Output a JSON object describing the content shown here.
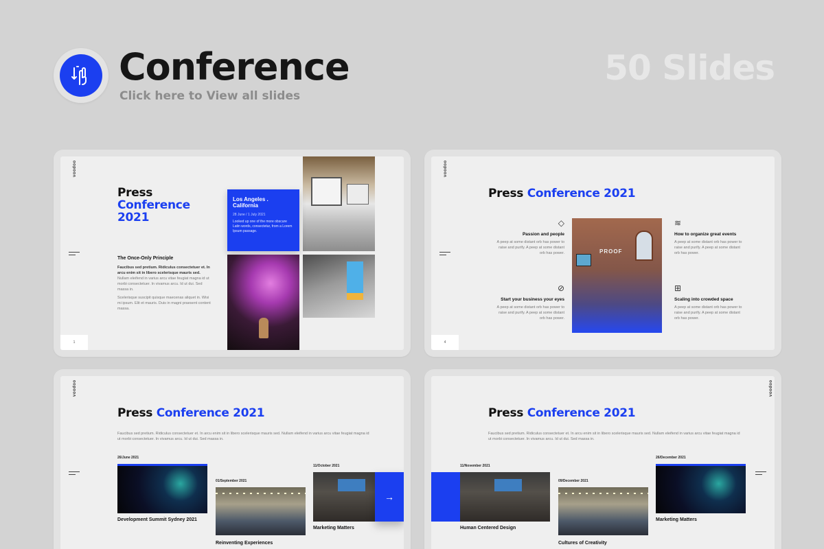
{
  "header": {
    "title": "Conference",
    "subtitle": "Click here to View all slides",
    "slides_count": "50 Slides",
    "logo_icon": "hand-swipe-icon"
  },
  "colors": {
    "accent": "#1b3ff0",
    "background": "#d3d3d3"
  },
  "brand": "voodoo",
  "slide1": {
    "title_line1": "Press",
    "title_line2": "Conference",
    "title_line3": "2021",
    "box_location": "Los Angeles . California",
    "box_date": "28 June / 1 July 2021",
    "box_desc": "Looked up one of the more obscure Latin words, consectetur, from a Lorem Ipsum passage.",
    "section_heading": "The Once-Only Principle",
    "para1_bold": "Faucibus sed pretium. Ridiculus consectetuer et. In arcu enim sit in libero scelerisque mauris sed.",
    "para1": "Nullam eleifend in varius arcu vitae feugiat magna id ut morbi consectetuer. In vivamus arcu. Id ut dui. Sed massa in.",
    "para2": "Scelerisque suscipit quisque maecenas aliquet in. Wisi mi ipsum. Elit et mauris. Duis in magni praesent content massa.",
    "page": "1"
  },
  "slide2": {
    "title_a": "Press",
    "title_b": "Conference 2021",
    "features": [
      {
        "icon": "diamond-icon",
        "label": "Passion and people",
        "text": "A peep at some distant orb has power to raise and purify. A peep at some distant orb has power."
      },
      {
        "icon": "layers-icon",
        "label": "How to organize great events",
        "text": "A peep at some distant orb has power to raise and purify. A peep at some distant orb has power."
      },
      {
        "icon": "badge-icon",
        "label": "Start your business your eyes",
        "text": "A peep at some distant orb has power to raise and purify. A peep at some distant orb has power."
      },
      {
        "icon": "gift-icon",
        "label": "Scaling into crowded space",
        "text": "A peep at some distant orb has power to raise and purify. A peep at some distant orb has power."
      }
    ],
    "photo_sign": "PROOF",
    "page": "4"
  },
  "slide3": {
    "title_a": "Press",
    "title_b": "Conference 2021",
    "desc": "Faucibus sed pretium. Ridiculus consectetuer et. In arcu enim sit in libero scelerisque mauris sed. Nullam eleifend in varius arcu vitae feugiat magna id ut morbi consectetuer. In vivamus arcu. Id ut dui. Sed massa in.",
    "events": [
      {
        "date": "26/June 2021",
        "name": "Development Summit Sydney 2021"
      },
      {
        "date": "01/September 2021",
        "name": "Reinventing Experiences"
      },
      {
        "date": "11/October 2021",
        "name": "Marketing Matters"
      }
    ],
    "arrow": "→"
  },
  "slide4": {
    "title_a": "Press",
    "title_b": "Conference 2021",
    "desc": "Faucibus sed pretium. Ridiculus consectetuer et. In arcu enim sit in libero scelerisque mauris sed. Nullam eleifend in varius arcu vitae feugiat magna id ut morbi consectetuer. In vivamus arcu. Id ut dui. Sed massa in.",
    "events": [
      {
        "date": "11/November 2021",
        "name": "Human Centered Design"
      },
      {
        "date": "09/December 2021",
        "name": "Cultures of Creativity"
      },
      {
        "date": "26/December 2021",
        "name": "Marketing Matters"
      }
    ]
  }
}
